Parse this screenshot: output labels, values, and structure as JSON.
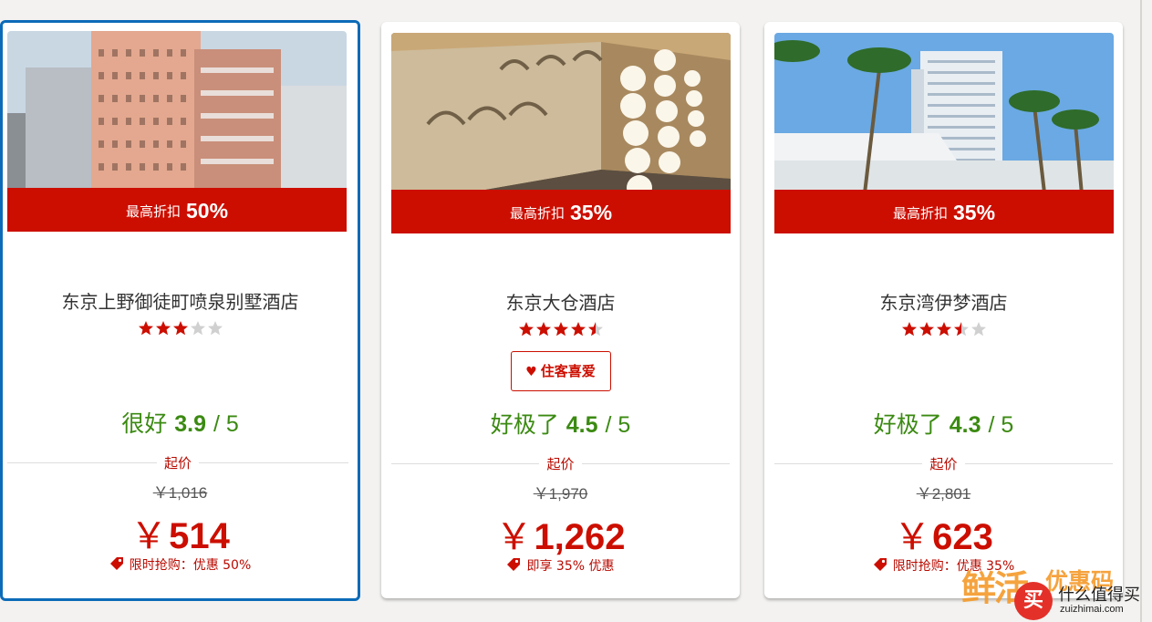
{
  "hotels": [
    {
      "discount_label": "最高折扣",
      "discount_value": "50%",
      "name": "东京上野御徒町喷泉别墅酒店",
      "star_rating": 3,
      "badge": null,
      "rating_word": "很好",
      "rating_score": "3.9",
      "rating_outof": "/ 5",
      "from_label": "起价",
      "original_price": "￥1,016",
      "currency": "￥",
      "price": "514",
      "deal_text": "限时抢购：优惠 50%",
      "selected": true
    },
    {
      "discount_label": "最高折扣",
      "discount_value": "35%",
      "name": "东京大仓酒店",
      "star_rating": 4.5,
      "badge": "住客喜爱",
      "rating_word": "好极了",
      "rating_score": "4.5",
      "rating_outof": "/ 5",
      "from_label": "起价",
      "original_price": "￥1,970",
      "currency": "￥",
      "price": "1,262",
      "deal_text": "即享 35% 优惠",
      "selected": false
    },
    {
      "discount_label": "最高折扣",
      "discount_value": "35%",
      "name": "东京湾伊梦酒店",
      "star_rating": 3.5,
      "badge": null,
      "rating_word": "好极了",
      "rating_score": "4.3",
      "rating_outof": "/ 5",
      "from_label": "起价",
      "original_price": "￥2,801",
      "currency": "￥",
      "price": "623",
      "deal_text": "限时抢购：优惠 35%",
      "selected": false
    }
  ],
  "watermark": {
    "big_text": "鲜活",
    "small_text": "优惠码",
    "logo_char": "买",
    "name": "什么值得买",
    "url": "zuizhimai.com"
  },
  "colors": {
    "brand_red": "#cc0e00",
    "rating_green": "#3b8a12",
    "selected_border": "#0c6bb8",
    "star_empty": "#d0d0d0"
  }
}
